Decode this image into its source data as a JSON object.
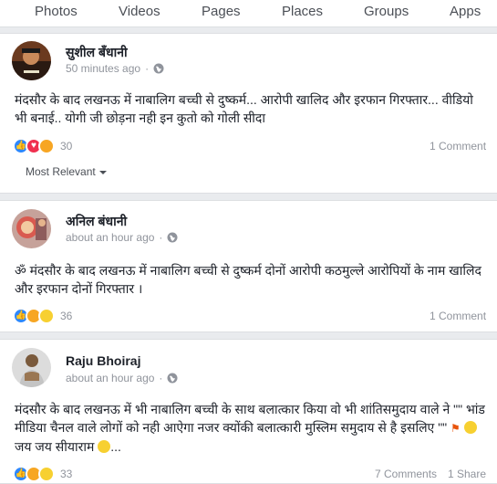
{
  "nav": {
    "tabs": [
      {
        "label": "Photos"
      },
      {
        "label": "Videos"
      },
      {
        "label": "Pages"
      },
      {
        "label": "Places"
      },
      {
        "label": "Groups"
      },
      {
        "label": "Apps"
      }
    ]
  },
  "posts": [
    {
      "author": "सुशील बँधानी",
      "time": "50 minutes ago",
      "dot": "·",
      "text": "मंदसौर के बाद लखनऊ में नाबालिग बच्ची से दुष्कर्म... आरोपी खालिद और इरफान गिरफ्तार... वीडियो भी बनाई.. योगी जी छोड़ना नही इन कुतो को गोली सीदा",
      "reactions": [
        "like",
        "love",
        "angry"
      ],
      "reaction_count": "30",
      "comments": "1 Comment",
      "sort_label": "Most Relevant"
    },
    {
      "author": "अनिल बंधानी",
      "time": "about an hour ago",
      "dot": "·",
      "text": "ॐ मंदसौर के बाद लखनऊ में नाबालिग बच्ची से दुष्कर्म दोनों आरोपी कठमुल्ले आरोपियों के नाम खालिद और इरफान दोनों गिरफ्तार ।",
      "reactions": [
        "like",
        "angry",
        "sad"
      ],
      "reaction_count": "36",
      "comments": "1 Comment"
    },
    {
      "author": "Raju Bhoiraj",
      "time": "about an hour ago",
      "dot": "·",
      "text_part1": "मंदसौर के बाद लखनऊ में भी नाबालिग बच्ची के साथ बलात्कार किया वो भी शांतिसमुदाय वाले ने \"\" भांड मीडिया चैनल वाले लोगों को नही आऐगा नजर क्योंकी बलात्कारी मुस्लिम समुदाय से है इसलिए \"\" ",
      "text_part2": " जय जय सीयाराम ",
      "text_part3": "...",
      "reactions": [
        "like",
        "angry",
        "haha"
      ],
      "reaction_count": "33",
      "comments": "7 Comments",
      "shares": "1 Share"
    }
  ],
  "colors": {
    "like": "#2d88ff",
    "love": "#f0304f",
    "angry": "#f7a623",
    "meta_gray": "#90949c"
  }
}
